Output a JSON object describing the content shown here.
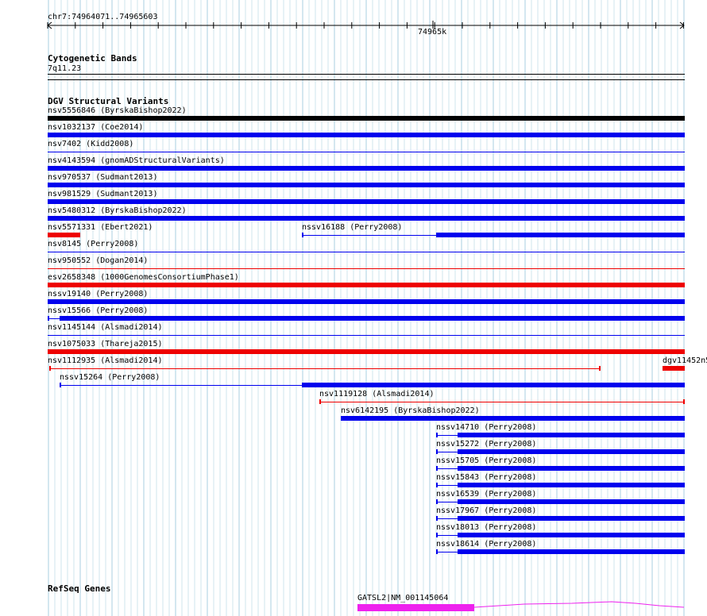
{
  "ruler": {
    "coord_range": "chr7:74964071..74965603",
    "center_label": "74965k"
  },
  "cytoband": {
    "title": "Cytogenetic Bands",
    "band": "7q11.23"
  },
  "dgv": {
    "title": "DGV Structural Variants",
    "variants": [
      {
        "label": "nsv5556846 (ByrskaBishop2022)",
        "color": "#000000",
        "style": "thick"
      },
      {
        "label": "nsv1032137 (Coe2014)",
        "color": "#0000ee",
        "style": "thick"
      },
      {
        "label": "nsv7402 (Kidd2008)",
        "color": "#0000ee",
        "style": "thin"
      },
      {
        "label": "nsv4143594 (gnomADStructuralVariants)",
        "color": "#0000ee",
        "style": "thick"
      },
      {
        "label": "nsv970537 (Sudmant2013)",
        "color": "#0000ee",
        "style": "thick"
      },
      {
        "label": "nsv981529 (Sudmant2013)",
        "color": "#0000ee",
        "style": "thick"
      },
      {
        "label": "nsv5480312 (ByrskaBishop2022)",
        "color": "#0000ee",
        "style": "thick"
      },
      {
        "label": "nsv5571331 (Ebert2021)",
        "color": "#ee0000",
        "style": "thick"
      },
      {
        "label": "nssv16188 (Perry2008)",
        "color": "#0000ee",
        "style": "split"
      },
      {
        "label": "nsv8145 (Perry2008)",
        "color": "#0000ee",
        "style": "thin"
      },
      {
        "label": "nsv950552 (Dogan2014)",
        "color": "#ee0000",
        "style": "thin"
      },
      {
        "label": "esv2658348 (1000GenomesConsortiumPhase1)",
        "color": "#ee0000",
        "style": "thick"
      },
      {
        "label": "nssv19140 (Perry2008)",
        "color": "#0000ee",
        "style": "thick"
      },
      {
        "label": "nssv15566 (Perry2008)",
        "color": "#0000ee",
        "style": "split"
      },
      {
        "label": "nsv1145144 (Alsmadi2014)",
        "color": "#0000ee",
        "style": "thin"
      },
      {
        "label": "nsv1075033 (Thareja2015)",
        "color": "#ee0000",
        "style": "thick"
      },
      {
        "label": "nsv1112935 (Alsmadi2014)",
        "color": "#ee0000",
        "style": "thin"
      },
      {
        "label": "dgv11452n5",
        "color": "#ee0000",
        "style": "thick"
      },
      {
        "label": "nssv15264 (Perry2008)",
        "color": "#0000ee",
        "style": "split"
      },
      {
        "label": "nsv1119128 (Alsmadi2014)",
        "color": "#ee0000",
        "style": "thin"
      },
      {
        "label": "nsv6142195 (ByrskaBishop2022)",
        "color": "#0000ee",
        "style": "thick"
      },
      {
        "label": "nssv14710 (Perry2008)",
        "color": "#0000ee",
        "style": "split"
      },
      {
        "label": "nssv15272 (Perry2008)",
        "color": "#0000ee",
        "style": "split"
      },
      {
        "label": "nssv15705 (Perry2008)",
        "color": "#0000ee",
        "style": "split"
      },
      {
        "label": "nssv15843 (Perry2008)",
        "color": "#0000ee",
        "style": "split"
      },
      {
        "label": "nssv16539 (Perry2008)",
        "color": "#0000ee",
        "style": "split"
      },
      {
        "label": "nssv17967 (Perry2008)",
        "color": "#0000ee",
        "style": "split"
      },
      {
        "label": "nssv18013 (Perry2008)",
        "color": "#0000ee",
        "style": "split"
      },
      {
        "label": "nssv18614 (Perry2008)",
        "color": "#0000ee",
        "style": "split"
      }
    ]
  },
  "refseq": {
    "title": "RefSeq Genes",
    "gene_label": "GATSL2|NM_001145064",
    "color": "#ee22ee"
  }
}
